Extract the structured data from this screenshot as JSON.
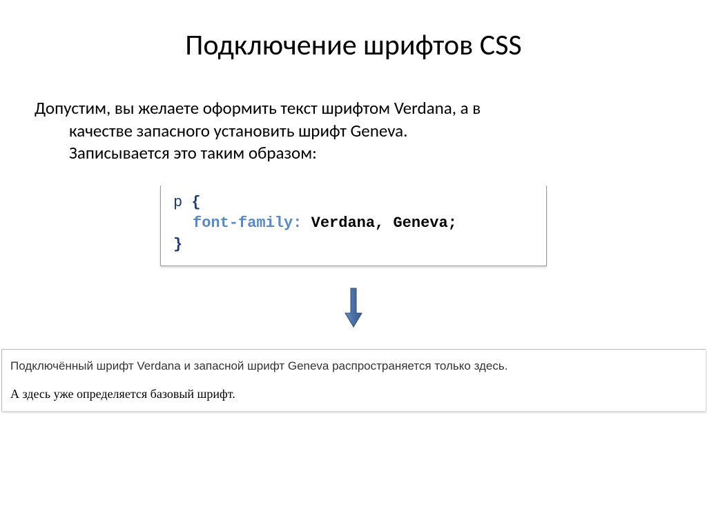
{
  "title": "Подключение шрифтов CSS",
  "intro": {
    "line1": "Допустим, вы желаете оформить текст шрифтом Verdana, а в",
    "line2": "качестве запасного установить шрифт Geneva.",
    "line3": "Записывается это таким образом:"
  },
  "code": {
    "selector": "p",
    "brace_open": "{",
    "property": "font-family",
    "colon": ":",
    "value": " Verdana, Geneva;",
    "brace_close": "}"
  },
  "result": {
    "verdana_text": "Подключённый шрифт Verdana и запасной шрифт Geneva распространяется только здесь.",
    "serif_text": "А здесь уже определяется базовый шрифт."
  }
}
